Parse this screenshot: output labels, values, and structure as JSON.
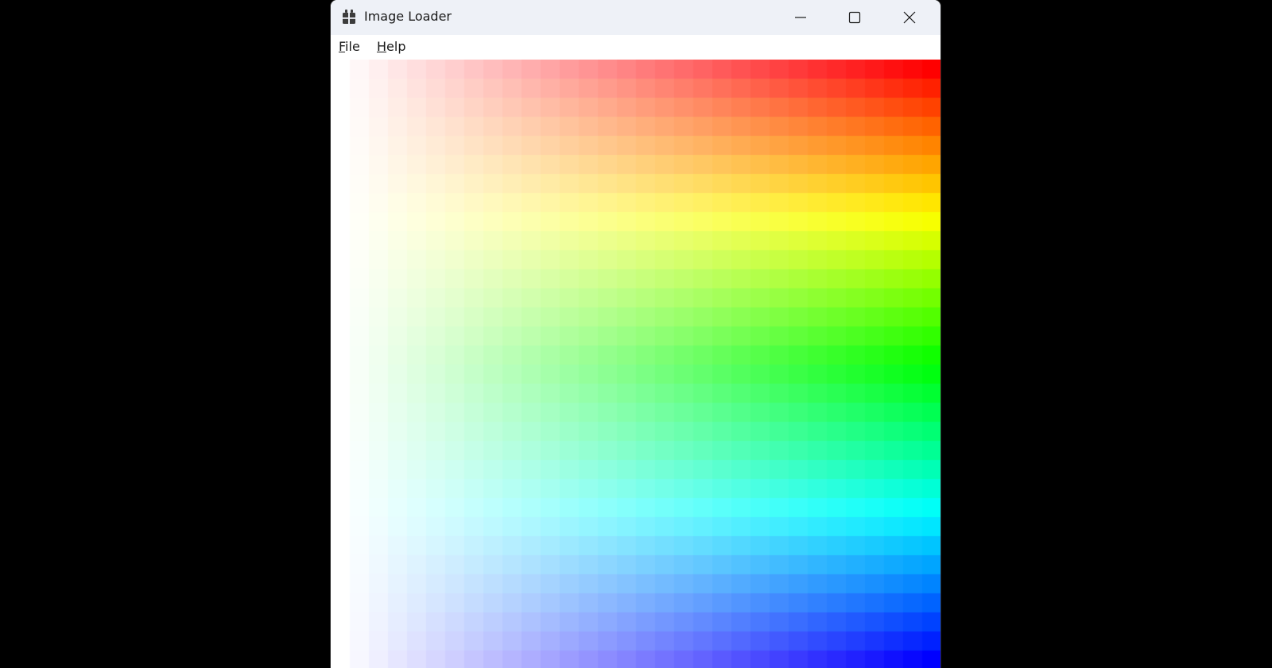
{
  "window": {
    "title": "Image Loader",
    "icon": "app-icon"
  },
  "caption_buttons": {
    "minimize_icon": "minimize-icon",
    "maximize_icon": "maximize-icon",
    "close_icon": "close-icon"
  },
  "menu": {
    "items": [
      {
        "mnemonic": "F",
        "rest": "ile"
      },
      {
        "mnemonic": "H",
        "rest": "elp"
      }
    ]
  },
  "image": {
    "description_free": true,
    "grid_columns": 32,
    "grid_rows": 32,
    "horizontal": "white to full saturation",
    "vertical": "hue from red through yellow, green, cyan to blue",
    "hue_stops": [
      "#ff0000",
      "#ffff00",
      "#00ff00",
      "#00ffff",
      "#0000ff"
    ]
  },
  "colors": {
    "desktop": "#000000",
    "titlebar": "#eef1f7",
    "menubar": "#ffffff",
    "text": "#1a1a1a"
  }
}
